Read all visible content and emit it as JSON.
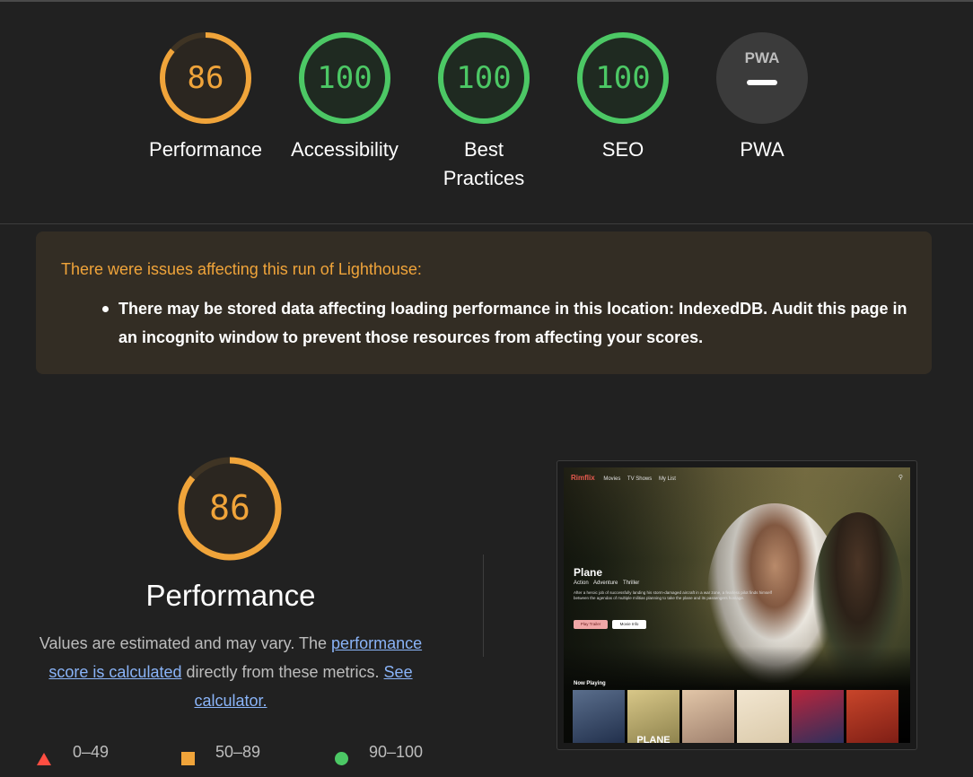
{
  "summary_gauges": [
    {
      "label": "Performance",
      "score": "86",
      "value": 86,
      "color": "#f0a43a",
      "track": "#3f3424",
      "fill_bg": "#2b2620"
    },
    {
      "label": "Accessibility",
      "score": "100",
      "value": 100,
      "color": "#4cc865",
      "track": "#24402a",
      "fill_bg": "#1f2a21"
    },
    {
      "label": "Best Practices",
      "score": "100",
      "value": 100,
      "color": "#4cc865",
      "track": "#24402a",
      "fill_bg": "#1f2a21"
    },
    {
      "label": "SEO",
      "score": "100",
      "value": 100,
      "color": "#4cc865",
      "track": "#24402a",
      "fill_bg": "#1f2a21"
    },
    {
      "label": "PWA",
      "badge_text": "PWA",
      "icon": "pwa-badge-icon",
      "color": "#bdbdbd",
      "fill_bg": "#3b3b3b"
    }
  ],
  "warning": {
    "title": "There were issues affecting this run of Lighthouse:",
    "items": [
      "There may be stored data affecting loading performance in this location: IndexedDB. Audit this page in an incognito window to prevent those resources from affecting your scores."
    ],
    "title_color": "#f0a43a",
    "background": "#332d24"
  },
  "performance": {
    "score": "86",
    "value": 86,
    "title": "Performance",
    "desc_prefix": "Values are estimated and may vary. The ",
    "desc_link1": "performance score is calculated",
    "desc_middle": " directly from these metrics. ",
    "desc_link2": "See calculator."
  },
  "legend": [
    {
      "range": "0–49",
      "shape": "triangle",
      "color": "#ff4e42"
    },
    {
      "range": "50–89",
      "shape": "square",
      "color": "#f0a43a"
    },
    {
      "range": "90–100",
      "shape": "circle",
      "color": "#4cc865"
    }
  ],
  "screenshot": {
    "brand": "Rimflix",
    "nav": [
      "Movies",
      "TV Shows",
      "My List"
    ],
    "search_icon": "search-icon",
    "movie_title": "Plane",
    "genres": [
      "Action",
      "Adventure",
      "Thriller"
    ],
    "synopsis": "After a heroic job of successfully landing his storm-damaged aircraft in a war zone, a fearless pilot finds himself between the agendas of multiple militias planning to take the plane and its passengers hostage.",
    "btn_trailer": "Play Trailer",
    "btn_info": "Movie Info",
    "section": "Now Playing",
    "posters": [
      {
        "text": "",
        "colors": [
          "#1e2c48",
          "#5a6e8c"
        ]
      },
      {
        "text": "PLANE",
        "colors": [
          "#8a7f4a",
          "#d8c788"
        ]
      },
      {
        "text": "",
        "colors": [
          "#9b7c6a",
          "#e2c6a8"
        ]
      },
      {
        "text": "",
        "colors": [
          "#d9c8a8",
          "#f2e6d0"
        ]
      },
      {
        "text": "",
        "colors": [
          "#24305e",
          "#b8253c"
        ]
      },
      {
        "text": "",
        "colors": [
          "#7a1c14",
          "#c8452a"
        ]
      }
    ]
  }
}
